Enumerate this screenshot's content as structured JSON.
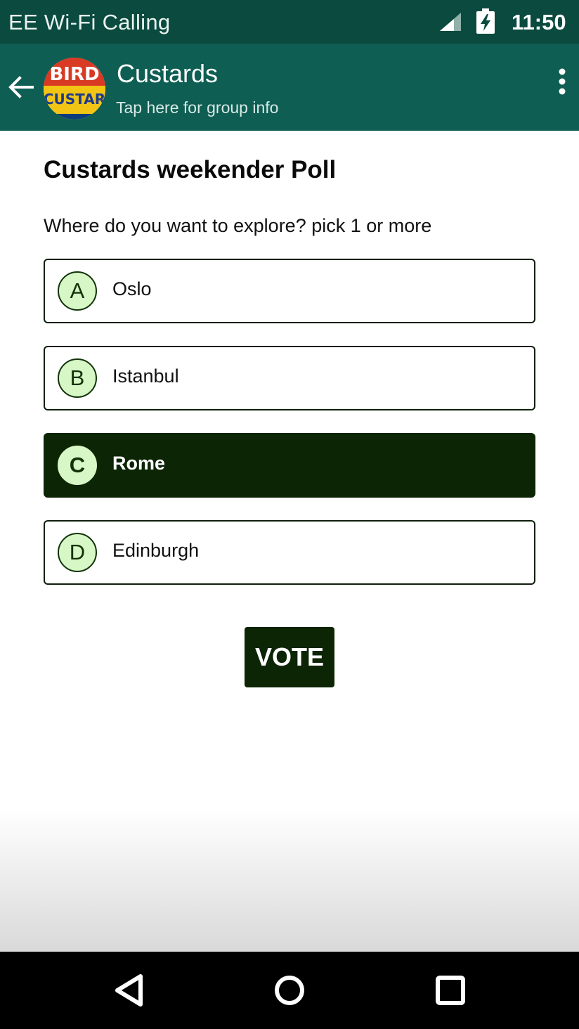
{
  "status_bar": {
    "carrier": "EE Wi-Fi Calling",
    "time": "11:50",
    "icons": [
      "signal-icon",
      "battery-charging-icon"
    ]
  },
  "app_bar": {
    "title": "Custards",
    "subtitle": "Tap here for group info",
    "avatar_text": [
      "BIRD",
      "CUSTAR"
    ],
    "icons": [
      "back-arrow-icon",
      "more-vert-icon"
    ]
  },
  "poll": {
    "title": "Custards weekender Poll",
    "question": "Where do you want to explore? pick 1 or more",
    "options": [
      {
        "letter": "A",
        "label": "Oslo",
        "selected": false
      },
      {
        "letter": "B",
        "label": "Istanbul",
        "selected": false
      },
      {
        "letter": "C",
        "label": "Rome",
        "selected": true
      },
      {
        "letter": "D",
        "label": "Edinburgh",
        "selected": false
      }
    ],
    "vote_label": "VOTE"
  },
  "nav_bar": {
    "icons": [
      "nav-back-icon",
      "nav-home-icon",
      "nav-recents-icon"
    ]
  },
  "colors": {
    "status_bar": "#0a4a3f",
    "app_bar": "#0e5e53",
    "selected_option": "#0c2504",
    "badge_fill": "#d8f7c6"
  }
}
